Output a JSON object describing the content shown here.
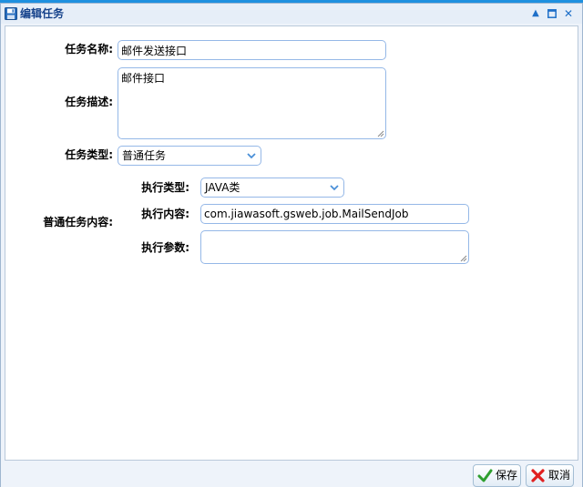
{
  "window": {
    "title": "编辑任务",
    "icons": [
      "save-icon",
      "collapse-icon",
      "maximize-icon",
      "close-icon"
    ]
  },
  "form": {
    "task_name": {
      "label": "任务名称:",
      "value": "邮件发送接口"
    },
    "task_desc": {
      "label": "任务描述:",
      "value": "邮件接口"
    },
    "task_type": {
      "label": "任务类型:",
      "selected": "普通任务"
    },
    "normal_content_label": "普通任务内容:",
    "exec_type": {
      "label": "执行类型:",
      "selected": "JAVA类"
    },
    "exec_content": {
      "label": "执行内容:",
      "value": "com.jiawasoft.gsweb.job.MailSendJob"
    },
    "exec_params": {
      "label": "执行参数:",
      "value": ""
    }
  },
  "footer": {
    "save_label": "保存",
    "cancel_label": "取消"
  },
  "colors": {
    "accent": "#1e90e0",
    "title_text": "#15428b",
    "field_border": "#95b8e7",
    "save_check": "#2e9e2e",
    "cancel_x": "#e02020"
  }
}
